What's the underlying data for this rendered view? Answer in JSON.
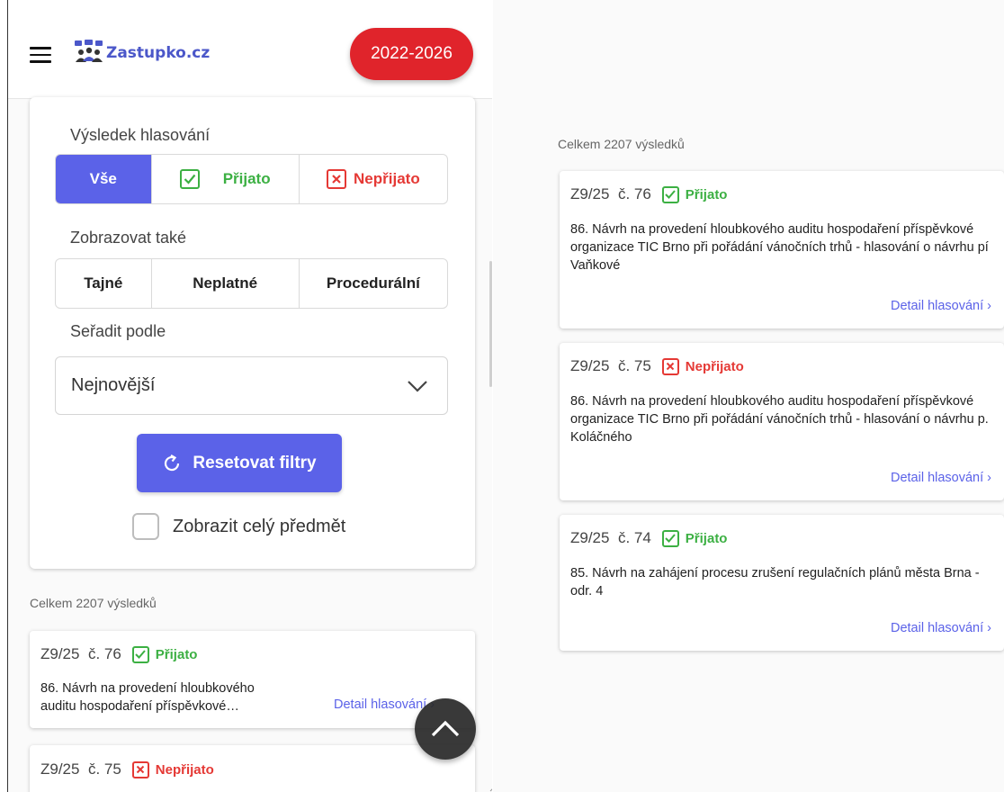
{
  "header": {
    "logo_text": "Zastupko.cz",
    "period_button": "2022-2026"
  },
  "filters": {
    "result_label": "Výsledek hlasování",
    "result_options": [
      {
        "label": "Vše",
        "active": true
      },
      {
        "label": "Přijato",
        "icon": "check-box-icon"
      },
      {
        "label": "Nepřijato",
        "icon": "x-box-icon"
      }
    ],
    "show_also_label": "Zobrazovat také",
    "show_also_options": [
      "Tajné",
      "Neplatné",
      "Procedurální"
    ],
    "sort_label": "Seřadit podle",
    "sort_value": "Nejnovější",
    "reset_label": "Resetovat filtry",
    "show_full_subject_label": "Zobrazit celý předmět",
    "show_full_subject_checked": false
  },
  "results": {
    "count_text": "Celkem 2207 výsledků",
    "detail_label": "Detail hlasování",
    "items": [
      {
        "session": "Z9/25",
        "number": "č. 76",
        "status": "Přijato",
        "full": "86. Návrh na provedení hloubkového auditu hospodaření příspěvkové organizace TIC Brno při pořádání vánočních trhů - hlasování o návrhu pí Vaňkové",
        "short_line1": "86. Návrh na provedení hloubkového",
        "short_line2": "auditu hospodaření příspěvkové…"
      },
      {
        "session": "Z9/25",
        "number": "č. 75",
        "status": "Nepřijato",
        "full": "86. Návrh na provedení hloubkového auditu hospodaření příspěvkové organizace TIC Brno při pořádání vánočních trhů - hlasování o návrhu p. Koláčného"
      },
      {
        "session": "Z9/25",
        "number": "č. 74",
        "status": "Přijato",
        "full": "85. Návrh na zahájení procesu zrušení regulačních plánů města Brna - odr. 4"
      }
    ]
  },
  "colors": {
    "accent": "#5b62e8",
    "brand_red": "#e0242b",
    "accepted": "#3cb043",
    "rejected": "#e53935"
  }
}
